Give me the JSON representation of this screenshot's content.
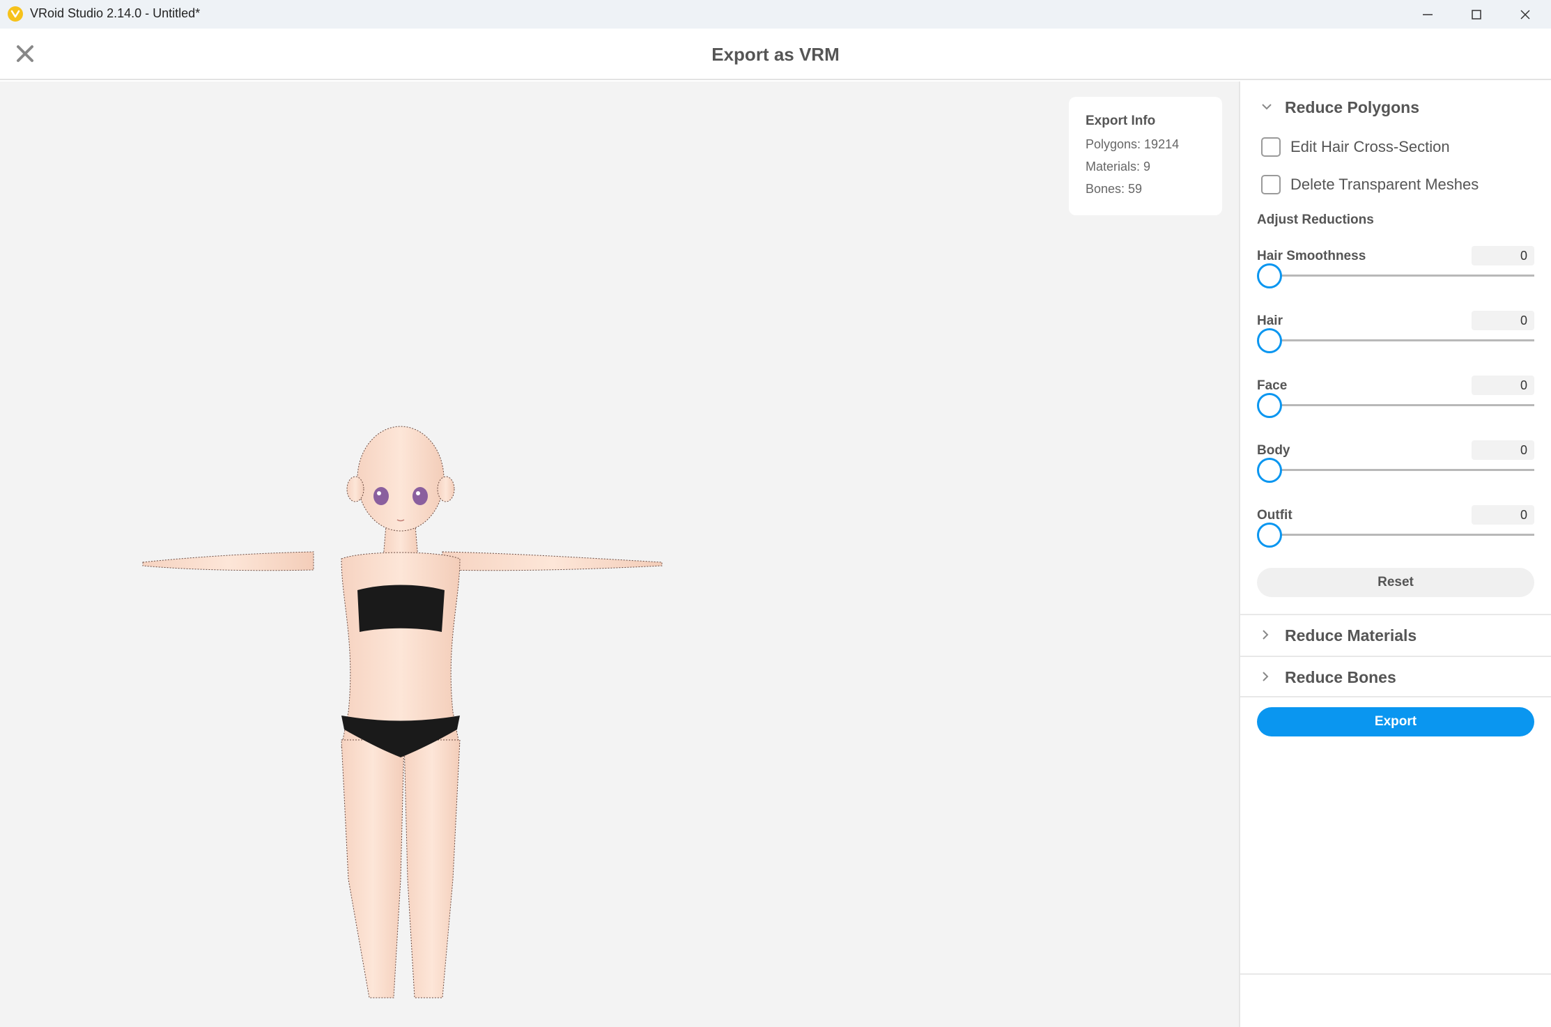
{
  "window": {
    "title": "VRoid Studio 2.14.0 - Untitled*",
    "app_icon": "vroid-logo-icon",
    "controls": [
      "minimize-icon",
      "maximize-icon",
      "close-icon"
    ]
  },
  "header": {
    "title": "Export as VRM",
    "close_icon": "close-icon"
  },
  "export_info": {
    "title": "Export Info",
    "polygons": "Polygons: 19214",
    "materials": "Materials: 9",
    "bones": "Bones: 59"
  },
  "panel": {
    "reduce_polygons": {
      "label": "Reduce Polygons",
      "expanded": true,
      "checkboxes": [
        {
          "label": "Edit Hair Cross-Section",
          "checked": false
        },
        {
          "label": "Delete Transparent Meshes",
          "checked": false
        }
      ],
      "adjust_label": "Adjust Reductions",
      "sliders": [
        {
          "name": "Hair Smoothness",
          "value": "0"
        },
        {
          "name": "Hair",
          "value": "0"
        },
        {
          "name": "Face",
          "value": "0"
        },
        {
          "name": "Body",
          "value": "0"
        },
        {
          "name": "Outfit",
          "value": "0"
        }
      ],
      "reset_label": "Reset"
    },
    "reduce_materials": {
      "label": "Reduce Materials",
      "expanded": false
    },
    "reduce_bones": {
      "label": "Reduce Bones",
      "expanded": false
    },
    "export_label": "Export"
  },
  "colors": {
    "accent": "#0a96f0",
    "viewport_bg": "#f3f3f3",
    "skin": "#fbe2d2",
    "underwear": "#1a1a1a"
  }
}
